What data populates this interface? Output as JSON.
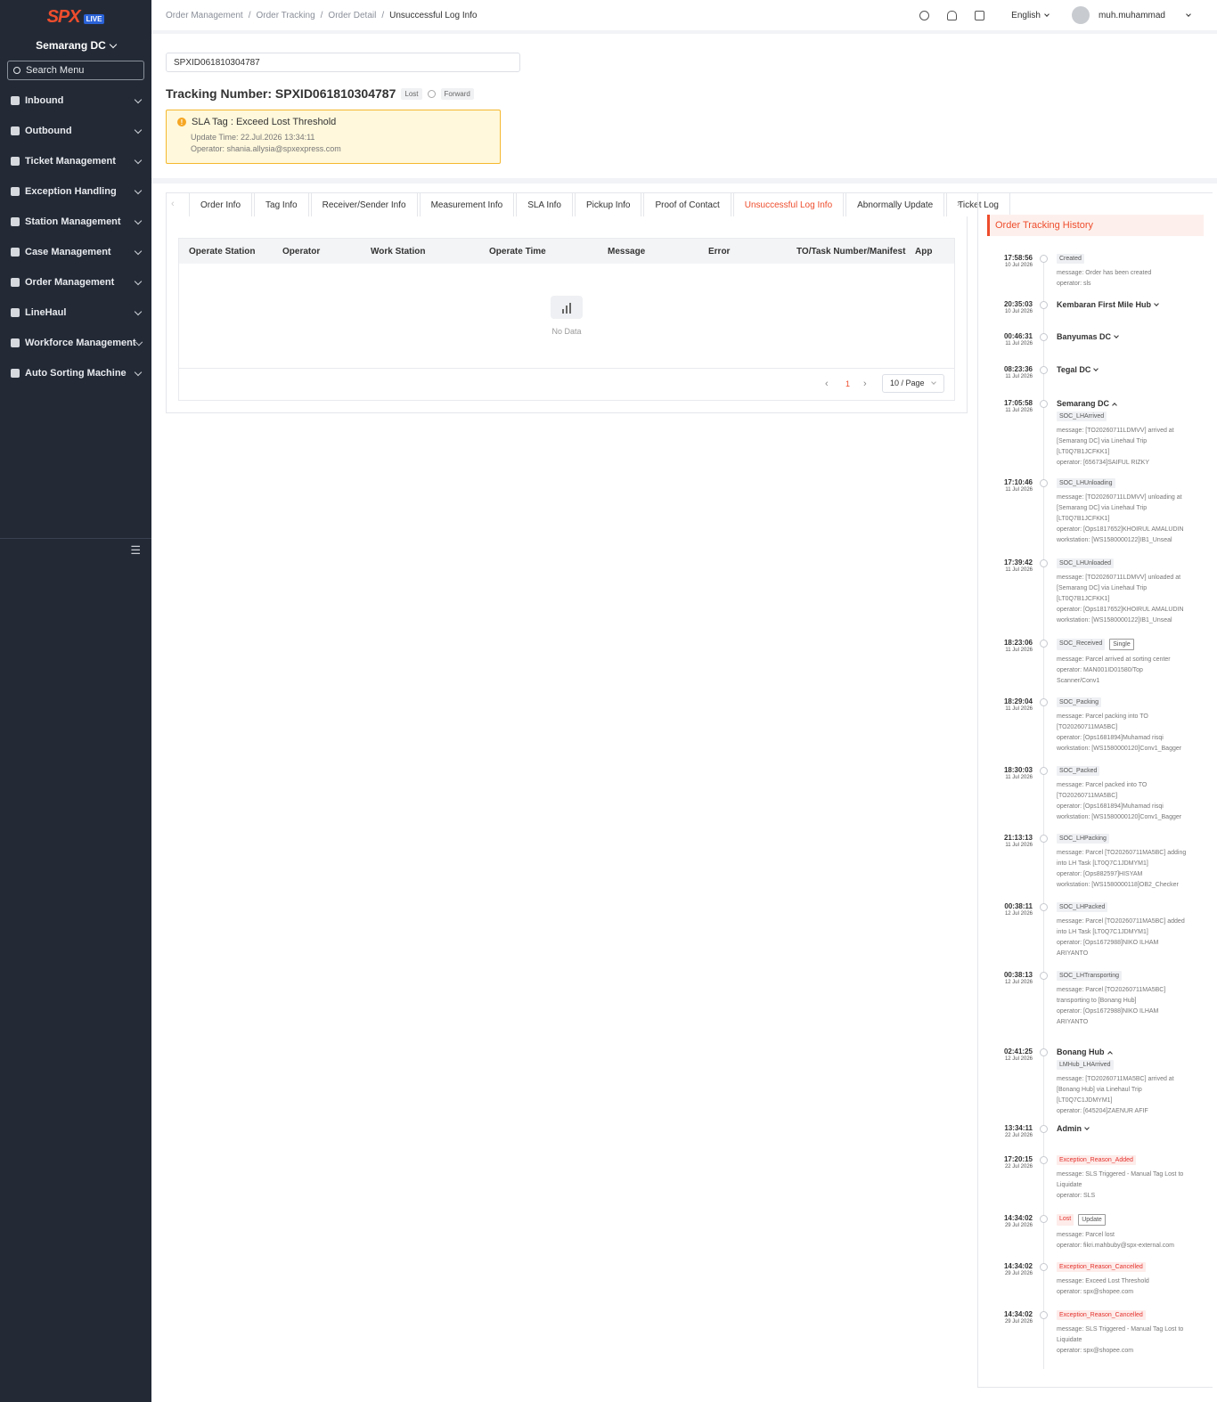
{
  "brand": {
    "logo": "SPX",
    "badge": "LIVE"
  },
  "sidebar": {
    "station": "Semarang DC",
    "search_placeholder": "Search Menu",
    "items": [
      {
        "label": "Inbound"
      },
      {
        "label": "Outbound"
      },
      {
        "label": "Ticket Management"
      },
      {
        "label": "Exception Handling"
      },
      {
        "label": "Station Management"
      },
      {
        "label": "Case Management"
      },
      {
        "label": "Order Management"
      },
      {
        "label": "LineHaul"
      },
      {
        "label": "Workforce Management"
      },
      {
        "label": "Auto Sorting Machine"
      }
    ]
  },
  "breadcrumb": [
    "Order Management",
    "Order Tracking",
    "Order Detail",
    "Unsuccessful Log Info"
  ],
  "topbar": {
    "language": "English",
    "user": "muh.muhammad"
  },
  "search_value": "SPXID061810304787",
  "tracking": {
    "title": "Tracking Number: SPXID061810304787",
    "tag_lost": "Lost",
    "tag_forward": "Forward"
  },
  "sla": {
    "title": "SLA Tag : Exceed Lost Threshold",
    "update": "Update Time: 22.Jul.2026 13:34:11",
    "operator": "Operator: shania.allysia@spxexpress.com"
  },
  "tabs": [
    "Order Info",
    "Tag Info",
    "Receiver/Sender Info",
    "Measurement Info",
    "SLA Info",
    "Pickup Info",
    "Proof of Contact",
    "Unsuccessful Log Info",
    "Abnormally Update",
    "Ticket Log"
  ],
  "active_tab": "Unsuccessful Log Info",
  "table": {
    "columns": [
      "Operate Station",
      "Operator",
      "Work Station",
      "Operate Time",
      "Message",
      "Error",
      "TO/Task Number/Manifest",
      "App"
    ],
    "empty_text": "No Data",
    "page": "1",
    "page_size": "10 / Page"
  },
  "history": {
    "title": "Order Tracking History",
    "events": [
      {
        "time": "17:58:56",
        "date": "10 Jul 2026",
        "tags": [
          "Created"
        ],
        "msg": "message: Order has been created|operator: sls"
      },
      {
        "time": "20:35:03",
        "date": "10 Jul 2026",
        "loc": "Kembaran First Mile Hub"
      },
      {
        "time": "00:46:31",
        "date": "11 Jul 2026",
        "loc": "Banyumas DC"
      },
      {
        "time": "08:23:36",
        "date": "11 Jul 2026",
        "loc": "Tegal DC"
      },
      {
        "time": "17:05:58",
        "date": "11 Jul 2026",
        "loc": "Semarang DC",
        "tags": [
          "SOC_LHArrived"
        ],
        "msg": "message: [TO20260711LDMVV] arrived at|[Semarang DC] via Linehaul Trip|[LT0Q7B1JCFKK1]|operator: [656734]SAIFUL RIZKY"
      },
      {
        "time": "17:10:46",
        "date": "11 Jul 2026",
        "tags": [
          "SOC_LHUnloading"
        ],
        "msg": "message: [TO20260711LDMVV] unloading at|[Semarang DC] via Linehaul Trip|[LT0Q7B1JCFKK1]|operator: [Ops1817652]KHOIRUL AMALUDIN|workstation: [WS1580000122]IB1_Unseal"
      },
      {
        "time": "17:39:42",
        "date": "11 Jul 2026",
        "tags": [
          "SOC_LHUnloaded"
        ],
        "msg": "message: [TO20260711LDMVV] unloaded at|[Semarang DC] via Linehaul Trip|[LT0Q7B1JCFKK1]|operator: [Ops1817652]KHOIRUL AMALUDIN|workstation: [WS1580000122]IB1_Unseal"
      },
      {
        "time": "18:23:06",
        "date": "11 Jul 2026",
        "tags": [
          "SOC_Received",
          "Single"
        ],
        "msg": "message: Parcel arrived at sorting center|operator: MAN001ID01580/Top|Scanner/Conv1"
      },
      {
        "time": "18:29:04",
        "date": "11 Jul 2026",
        "tags": [
          "SOC_Packing"
        ],
        "msg": "message: Parcel packing into TO|[TO20260711MA5BC]|operator: [Ops1681894]Muhamad risqi|workstation: [WS1580000120]Conv1_Bagger"
      },
      {
        "time": "18:30:03",
        "date": "11 Jul 2026",
        "tags": [
          "SOC_Packed"
        ],
        "msg": "message: Parcel packed into TO|[TO20260711MA5BC]|operator: [Ops1681894]Muhamad risqi|workstation: [WS1580000120]Conv1_Bagger"
      },
      {
        "time": "21:13:13",
        "date": "11 Jul 2026",
        "tags": [
          "SOC_LHPacking"
        ],
        "msg": "message: Parcel [TO20260711MA5BC] adding|into LH Task [LT0Q7C1JDMYM1]|operator: [Ops882597]HISYAM|workstation: [WS1580000118]OB2_Checker"
      },
      {
        "time": "00:38:11",
        "date": "12 Jul 2026",
        "tags": [
          "SOC_LHPacked"
        ],
        "msg": "message: Parcel [TO20260711MA5BC] added|into LH Task [LT0Q7C1JDMYM1]|operator: [Ops1672988]NIKO ILHAM|ARIYANTO"
      },
      {
        "time": "00:38:13",
        "date": "12 Jul 2026",
        "tags": [
          "SOC_LHTransporting"
        ],
        "msg": "message: Parcel [TO20260711MA5BC]|transporting to [Bonang Hub]|operator: [Ops1672988]NIKO ILHAM|ARIYANTO"
      },
      {
        "time": "02:41:25",
        "date": "12 Jul 2026",
        "loc": "Bonang Hub",
        "tags": [
          "LMHub_LHArrived"
        ],
        "msg": "message: [TO20260711MA5BC] arrived at|[Bonang Hub] via Linehaul Trip|[LT0Q7C1JDMYM1]|operator: [645204]ZAENUR AFIF"
      },
      {
        "time": "13:34:11",
        "date": "22 Jul 2026",
        "loc": "Admin"
      },
      {
        "time": "17:20:15",
        "date": "22 Jul 2026",
        "tags": [
          "Exception_Reason_Added"
        ],
        "msg": "message: SLS Triggered - Manual Tag Lost to|Liquidate|operator: SLS"
      },
      {
        "time": "14:34:02",
        "date": "29 Jul 2026",
        "tags": [
          "Lost",
          "Update"
        ],
        "msg": "message: Parcel lost|operator: fikri.mahbuby@spx-external.com"
      },
      {
        "time": "14:34:02",
        "date": "29 Jul 2026",
        "tags": [
          "Exception_Reason_Cancelled"
        ],
        "msg": "message: Exceed Lost Threshold|operator: spx@shopee.com"
      },
      {
        "time": "14:34:02",
        "date": "29 Jul 2026",
        "tags": [
          "Exception_Reason_Cancelled"
        ],
        "msg": "message: SLS Triggered - Manual Tag Lost to|Liquidate|operator: spx@shopee.com"
      }
    ]
  }
}
